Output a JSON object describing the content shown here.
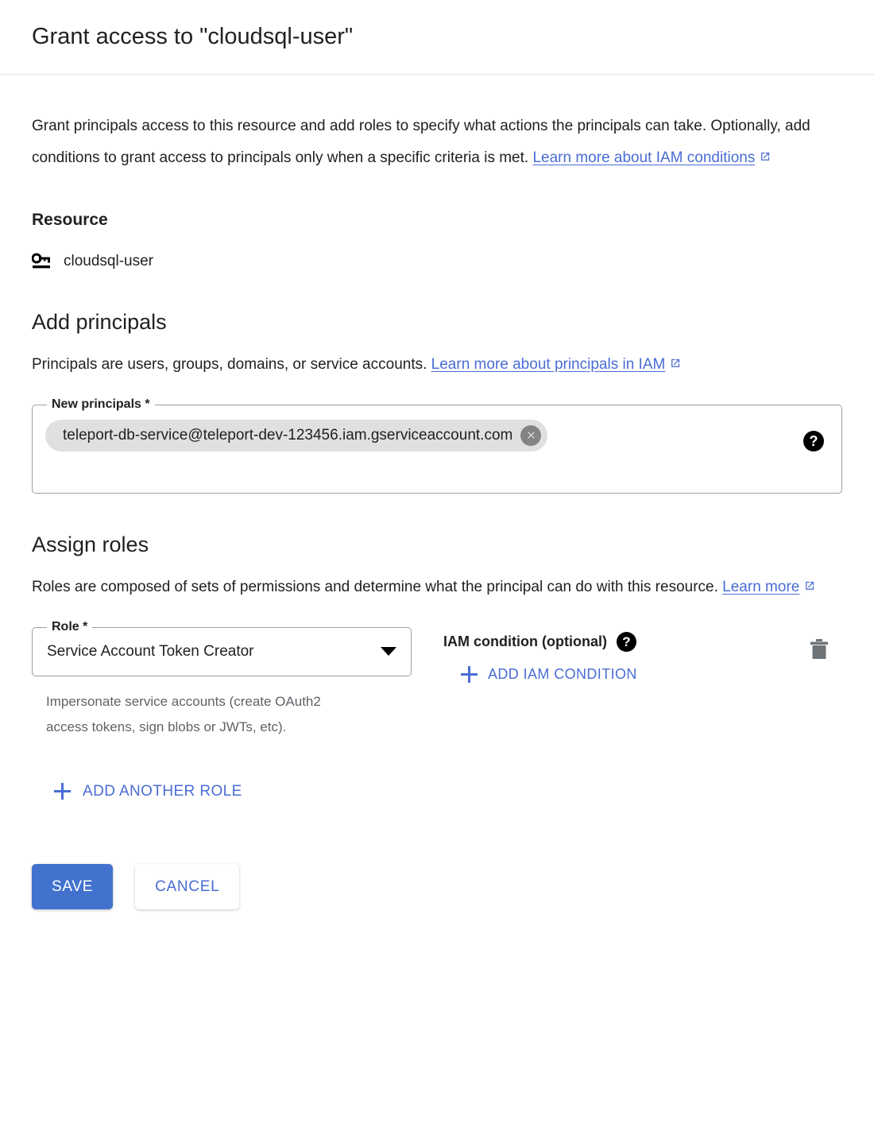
{
  "header": {
    "title": "Grant access to \"cloudsql-user\""
  },
  "intro": {
    "text": "Grant principals access to this resource and add roles to specify what actions the principals can take. Optionally, add conditions to grant access to principals only when a specific criteria is met.",
    "link_label": "Learn more about IAM conditions",
    "link_icon": "open-in-new-icon"
  },
  "resource": {
    "heading": "Resource",
    "icon": "key-icon",
    "name": "cloudsql-user"
  },
  "principals": {
    "heading": "Add principals",
    "description": "Principals are users, groups, domains, or service accounts.",
    "link_label": "Learn more about principals in IAM",
    "link_icon": "open-in-new-icon",
    "field_label": "New principals *",
    "chips": [
      {
        "value": "teleport-db-service@teleport-dev-123456.iam.gserviceaccount.com",
        "remove_icon": "close-circle-icon"
      }
    ],
    "help_icon": "help-icon",
    "help_glyph": "?"
  },
  "roles": {
    "heading": "Assign roles",
    "description": "Roles are composed of sets of permissions and determine what the principal can do with this resource.",
    "link_label": "Learn more",
    "link_icon": "open-in-new-icon",
    "rows": [
      {
        "role_label": "Role *",
        "role_value": "Service Account Token Creator",
        "role_hint": "Impersonate service accounts (create OAuth2 access tokens, sign blobs or JWTs, etc).",
        "condition_label": "IAM condition (optional)",
        "condition_help_glyph": "?",
        "condition_help_icon": "help-icon",
        "add_condition_label": "ADD IAM CONDITION",
        "delete_icon": "trash-icon"
      }
    ],
    "add_another_label": "ADD ANOTHER ROLE"
  },
  "footer": {
    "save_label": "SAVE",
    "cancel_label": "CANCEL"
  },
  "colors": {
    "link": "#4a6cd4",
    "primary_button": "#4272ce",
    "chip_background": "#e0e0e0",
    "chip_remove": "#848484",
    "hint_text": "#5f6368",
    "field_border": "#9aa0a6",
    "divider": "#e3e3e3"
  }
}
